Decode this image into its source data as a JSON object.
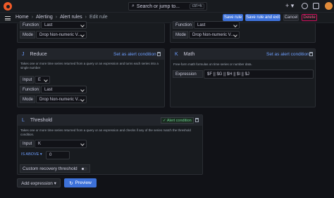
{
  "topbar": {
    "search_placeholder": "Search or jump to...",
    "search_shortcut": "ctrl+k",
    "plus_label": "+ ▾"
  },
  "breadcrumbs": [
    "Home",
    "Alerting",
    "Alert rules",
    "Edit rule"
  ],
  "separator": "›",
  "actions": {
    "save": "Save rule",
    "save_exit": "Save rule and exit",
    "cancel": "Cancel",
    "delete": "Delete"
  },
  "top_left": {
    "function_label": "Function",
    "function_value": "Last",
    "mode_label": "Mode",
    "mode_value": "Drop Non-numeric V..."
  },
  "top_right": {
    "function_label": "Function",
    "function_value": "Last",
    "mode_label": "Mode",
    "mode_value": "Drop Non-numeric V..."
  },
  "reduce": {
    "letter": "J",
    "title": "Reduce",
    "set_alert": "Set as alert condition",
    "description": "Takes one or more time series returned from a query or an expression and turns each series into a single number",
    "input_label": "Input",
    "input_value": "E",
    "function_label": "Function",
    "function_value": "Last",
    "mode_label": "Mode",
    "mode_value": "Drop Non-numeric V..."
  },
  "math": {
    "letter": "K",
    "title": "Math",
    "set_alert": "Set as alert condition",
    "description": "Free-form math formulas on time series or number data.",
    "expression_label": "Expression",
    "expression_value": "$F || $G || $H || $I || $J"
  },
  "threshold": {
    "letter": "L",
    "title": "Threshold",
    "badge": "✓ Alert condition",
    "description": "Takes one or more time series returned from a query or an expression and checks if any of the series match the threshold condition.",
    "input_label": "Input",
    "input_value": "K",
    "operator": "IS ABOVE ▾",
    "value": "0",
    "recovery_label": "Custom recovery threshold"
  },
  "footer": {
    "add_expression": "Add expression ▾",
    "preview": "Preview"
  }
}
